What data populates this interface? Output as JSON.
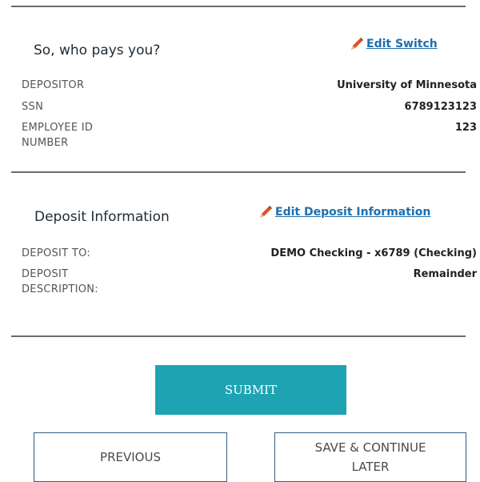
{
  "employer_section": {
    "title": "So, who pays you?",
    "edit_label": "Edit Switch",
    "rows": [
      {
        "label": "DEPOSITOR",
        "value": "University of Minnesota"
      },
      {
        "label": "SSN",
        "value": "6789123123"
      },
      {
        "label": "EMPLOYEE ID\nNUMBER",
        "value": "123"
      }
    ]
  },
  "deposit_section": {
    "title": "Deposit Information",
    "edit_label": "Edit Deposit Information",
    "rows": [
      {
        "label": "DEPOSIT TO:",
        "value": "DEMO Checking - x6789 (Checking)"
      },
      {
        "label": "DEPOSIT\nDESCRIPTION:",
        "value": "Remainder"
      }
    ]
  },
  "actions": {
    "submit_label": "SUBMIT",
    "previous_label": "PREVIOUS",
    "save_later_label": "SAVE & CONTINUE LATER"
  },
  "colors": {
    "accent": "#1ea3b3",
    "link": "#1e6fae",
    "pencil": "#d9541e",
    "button_border": "#2d5f8a"
  }
}
